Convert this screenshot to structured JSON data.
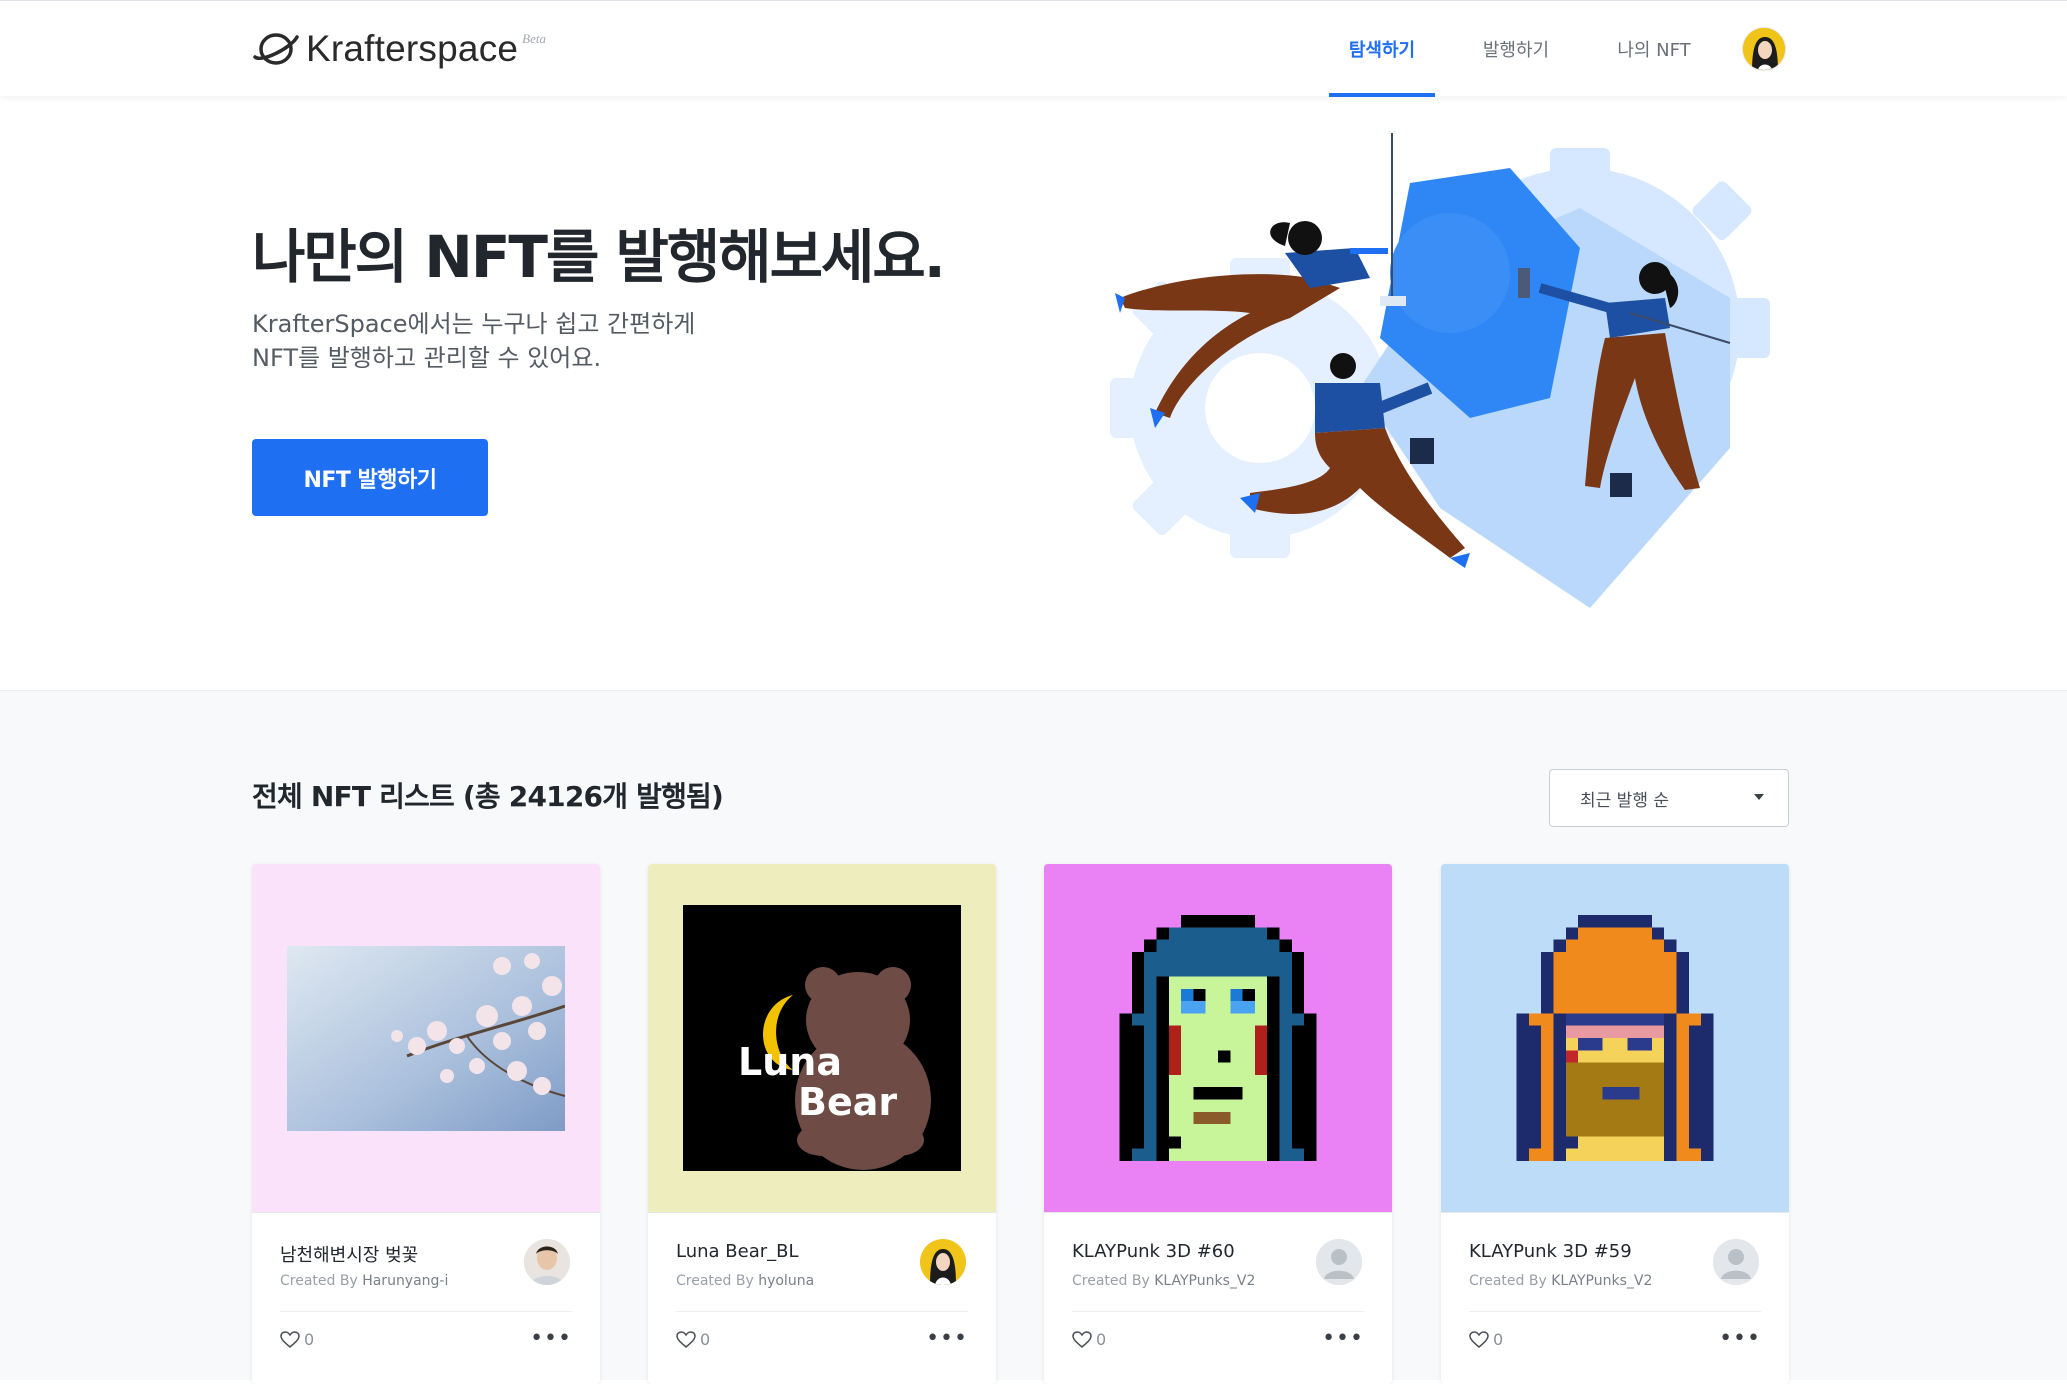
{
  "header": {
    "logo_text": "Krafterspace",
    "logo_badge": "Beta",
    "nav": [
      {
        "label": "탐색하기",
        "active": true
      },
      {
        "label": "발행하기",
        "active": false
      },
      {
        "label": "나의 NFT",
        "active": false
      }
    ],
    "accent_color": "#1f6ff2"
  },
  "hero": {
    "title": "나만의 NFT를 발행해보세요.",
    "description_line1": "KrafterSpace에서는 누구나 쉽고 간편하게",
    "description_line2": "NFT를 발행하고 관리할 수 있어요.",
    "cta_label": "NFT 발행하기"
  },
  "list": {
    "title": "전체 NFT 리스트 (총 24126개 발행됨)",
    "sort": {
      "selected": "최근 발행 순"
    },
    "created_by_prefix": "Created By",
    "cards": [
      {
        "title": "남천해변시장 벚꽃",
        "creator": "Harunyang-i",
        "likes": "0",
        "bg": "#fbe2fb",
        "avatar": "photo-avatar"
      },
      {
        "title": "Luna Bear_BL",
        "creator": "hyoluna",
        "likes": "0",
        "bg": "#eeedbd",
        "avatar": "illustrated-avatar"
      },
      {
        "title": "KLAYPunk 3D #60",
        "creator": "KLAYPunks_V2",
        "likes": "0",
        "bg": "#ea82f5",
        "avatar": "default-avatar"
      },
      {
        "title": "KLAYPunk 3D #59",
        "creator": "KLAYPunks_V2",
        "likes": "0",
        "bg": "#bcdcf7",
        "avatar": "default-avatar"
      }
    ]
  },
  "thumb_texts": {
    "luna_line1": "Luna",
    "luna_line2": "Bear"
  }
}
